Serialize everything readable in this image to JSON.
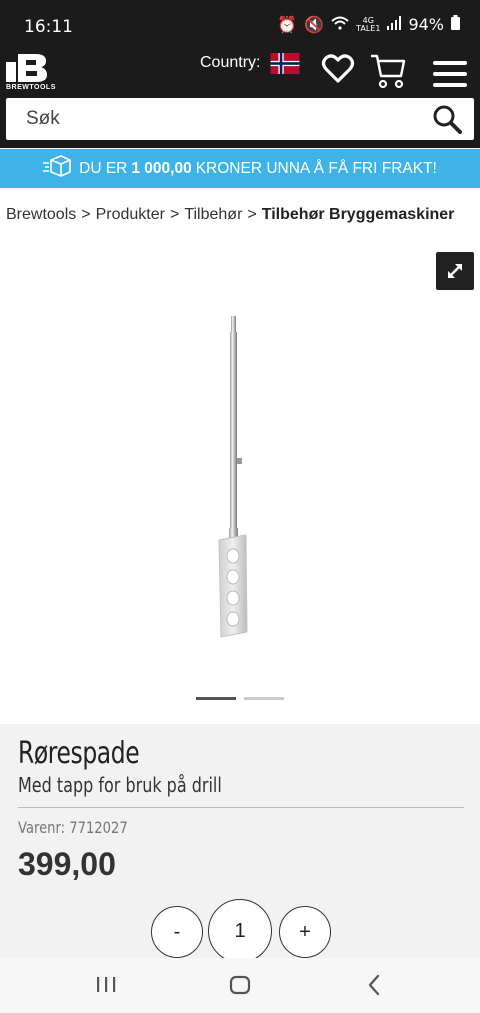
{
  "status_bar": {
    "time": "16:11",
    "network_top": "4G",
    "network_bottom": "TALE1",
    "battery": "94%"
  },
  "header": {
    "logo_text": "BREWTOOLS",
    "country_label": "Country:",
    "country_flag": "norway-flag"
  },
  "search": {
    "placeholder": "Søk"
  },
  "promo": {
    "prefix": "DU ER",
    "amount": "1 000,00",
    "suffix": "KRONER UNNA Å FÅ FRI FRAKT!"
  },
  "breadcrumb": {
    "items": [
      "Brewtools",
      "Produkter",
      "Tilbehør"
    ],
    "current": "Tilbehør Bryggemaskiner",
    "separator": ">"
  },
  "gallery": {
    "slide_count": 2,
    "active_slide": 1
  },
  "product": {
    "name": "Rørespade",
    "subtitle": "Med tapp for bruk på drill",
    "sku_label": "Varenr:",
    "sku": "7712027",
    "price": "399,00"
  },
  "quantity": {
    "minus": "-",
    "value": "1",
    "plus": "+"
  },
  "colors": {
    "header_bg": "#1b1b1b",
    "promo_bg": "#3fb3e6",
    "info_bg": "#f2f2f2"
  }
}
